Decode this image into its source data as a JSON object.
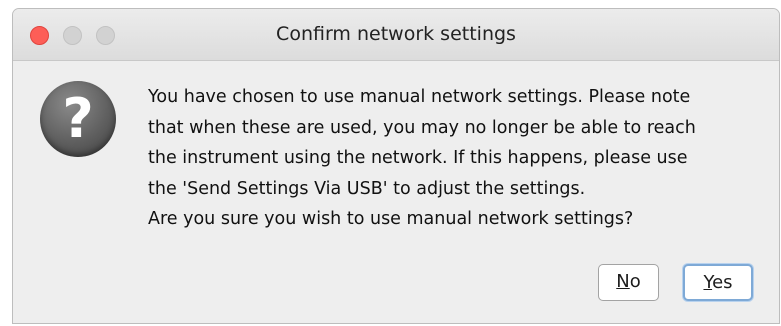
{
  "window": {
    "title": "Confirm network settings"
  },
  "icon": {
    "name": "question-icon",
    "glyph": "?"
  },
  "message": {
    "lines": [
      "You have chosen to use manual network settings. Please note",
      "that when these are used, you may no longer be able to reach",
      "the instrument using the network. If this happens, please use",
      "the 'Send Settings Via USB' to adjust the settings.",
      "Are you sure you wish to use manual network settings?"
    ]
  },
  "buttons": {
    "no": {
      "mnemonic": "N",
      "rest": "o"
    },
    "yes": {
      "mnemonic": "Y",
      "rest": "es"
    }
  },
  "colors": {
    "close_button": "#fd5e57",
    "inactive_button": "#d2d2d2",
    "default_button_focus": "#7ea9d6"
  }
}
